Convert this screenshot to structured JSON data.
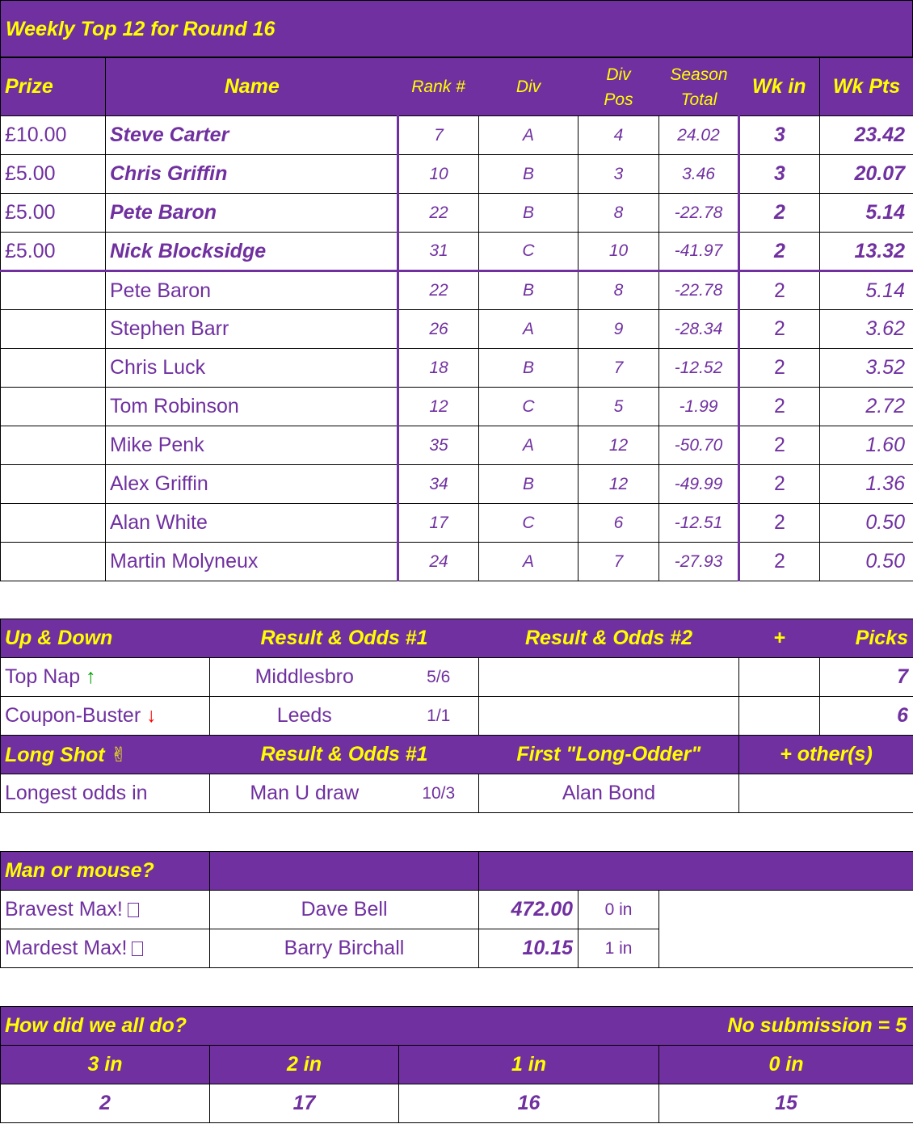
{
  "top12": {
    "title": "Weekly Top 12 for Round 16",
    "headers": {
      "prize": "Prize",
      "name": "Name",
      "rank": "Rank #",
      "div": "Div",
      "div_pos_1": "Div",
      "div_pos_2": "Pos",
      "season_1": "Season",
      "season_2": "Total",
      "wk_in": "Wk in",
      "wk_pts": "Wk Pts"
    },
    "rows": [
      {
        "prize": "£10.00",
        "name": "Steve Carter",
        "rank": "7",
        "div": "A",
        "pos": "4",
        "season": "24.02",
        "wk_in": "3",
        "wk_pts": "23.42"
      },
      {
        "prize": "£5.00",
        "name": "Chris Griffin",
        "rank": "10",
        "div": "B",
        "pos": "3",
        "season": "3.46",
        "wk_in": "3",
        "wk_pts": "20.07"
      },
      {
        "prize": "£5.00",
        "name": "Pete Baron",
        "rank": "22",
        "div": "B",
        "pos": "8",
        "season": "-22.78",
        "wk_in": "2",
        "wk_pts": "5.14"
      },
      {
        "prize": "£5.00",
        "name": "Nick Blocksidge",
        "rank": "31",
        "div": "C",
        "pos": "10",
        "season": "-41.97",
        "wk_in": "2",
        "wk_pts": "13.32"
      },
      {
        "prize": "",
        "name": "Pete Baron",
        "rank": "22",
        "div": "B",
        "pos": "8",
        "season": "-22.78",
        "wk_in": "2",
        "wk_pts": "5.14"
      },
      {
        "prize": "",
        "name": "Stephen Barr",
        "rank": "26",
        "div": "A",
        "pos": "9",
        "season": "-28.34",
        "wk_in": "2",
        "wk_pts": "3.62"
      },
      {
        "prize": "",
        "name": "Chris Luck",
        "rank": "18",
        "div": "B",
        "pos": "7",
        "season": "-12.52",
        "wk_in": "2",
        "wk_pts": "3.52"
      },
      {
        "prize": "",
        "name": "Tom Robinson",
        "rank": "12",
        "div": "C",
        "pos": "5",
        "season": "-1.99",
        "wk_in": "2",
        "wk_pts": "2.72"
      },
      {
        "prize": "",
        "name": "Mike Penk",
        "rank": "35",
        "div": "A",
        "pos": "12",
        "season": "-50.70",
        "wk_in": "2",
        "wk_pts": "1.60"
      },
      {
        "prize": "",
        "name": "Alex Griffin",
        "rank": "34",
        "div": "B",
        "pos": "12",
        "season": "-49.99",
        "wk_in": "2",
        "wk_pts": "1.36"
      },
      {
        "prize": "",
        "name": "Alan White",
        "rank": "17",
        "div": "C",
        "pos": "6",
        "season": "-12.51",
        "wk_in": "2",
        "wk_pts": "0.50"
      },
      {
        "prize": "",
        "name": "Martin Molyneux",
        "rank": "24",
        "div": "A",
        "pos": "7",
        "season": "-27.93",
        "wk_in": "2",
        "wk_pts": "0.50"
      }
    ]
  },
  "updown": {
    "headers": {
      "title": "Up & Down",
      "result1": "Result & Odds #1",
      "result2": "Result & Odds #2",
      "plus": "+",
      "picks": "Picks"
    },
    "rows": [
      {
        "label": "Top Nap",
        "arrow": "↑",
        "team": "Middlesbro",
        "odds": "5/6",
        "picks": "7"
      },
      {
        "label": "Coupon-Buster",
        "arrow": "↓",
        "team": "Leeds",
        "odds": "1/1",
        "picks": "6"
      }
    ],
    "longshot_headers": {
      "title": "Long Shot",
      "icon": "✌",
      "result1": "Result & Odds #1",
      "first": "First \"Long-Odder\"",
      "others": "+ other(s)"
    },
    "longshot": {
      "label": "Longest odds in",
      "team": "Man U draw",
      "odds": "10/3",
      "player": "Alan Bond"
    }
  },
  "manmouse": {
    "title": "Man or mouse?",
    "rows": [
      {
        "label": "Bravest Max!",
        "name": "Dave Bell",
        "value": "472.00",
        "in": "0 in"
      },
      {
        "label": "Mardest Max!",
        "name": "Barry Birchall",
        "value": "10.15",
        "in": "1 in"
      }
    ]
  },
  "summary": {
    "title": "How did we all do?",
    "note": "No submission = 5",
    "headers": [
      "3 in",
      "2 in",
      "1 in",
      "0 in"
    ],
    "values": [
      "2",
      "17",
      "16",
      "15"
    ]
  },
  "colors": {
    "header_bg": "#7030a0",
    "header_text": "#ffff00",
    "body_text": "#7030a0",
    "up_arrow": "#00a000",
    "down_arrow": "#ff0000"
  }
}
